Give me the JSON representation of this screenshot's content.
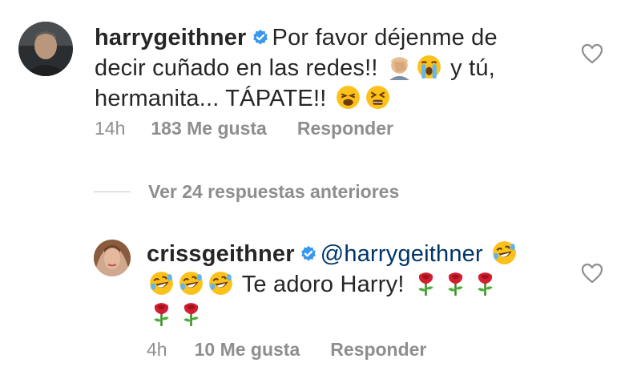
{
  "comment1": {
    "username": "harrygeithner",
    "line1_text": "Por favor déjenme de",
    "line2_text_a": "decir cuñado en las redes!!",
    "line2_text_b": "y tú,",
    "line3_text": "hermanita... TÁPATE!!",
    "timestamp": "14h",
    "likes": "183 Me gusta",
    "reply": "Responder"
  },
  "view_replies": "Ver 24 respuestas anteriores",
  "comment2": {
    "username": "crissgeithner",
    "mention": "@harrygeithner",
    "text": "Te adoro Harry!",
    "timestamp": "4h",
    "likes": "10 Me gusta",
    "reply": "Responder"
  },
  "icons": {
    "verified": "verified-badge-icon",
    "heart": "heart-outline-icon",
    "facepalm": "facepalm-emoji",
    "crying": "loudly-crying-emoji",
    "weary": "weary-face-emoji",
    "tired": "tired-face-emoji",
    "rofl": "rolling-on-floor-laughing-emoji",
    "rose": "rose-emoji"
  },
  "colors": {
    "verified_blue": "#3897f0",
    "meta_gray": "#8e8e8e",
    "mention_blue": "#003569"
  }
}
